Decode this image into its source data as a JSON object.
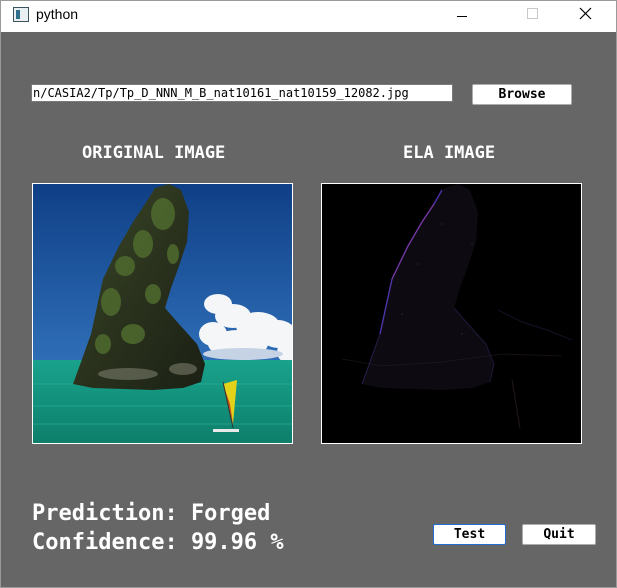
{
  "window": {
    "title": "python",
    "controls": [
      "minimize-icon",
      "maximize-icon",
      "close-icon"
    ]
  },
  "file": {
    "path_value": "n/CASIA2/Tp/Tp_D_NNN_M_B_nat10161_nat10159_12082.jpg",
    "browse_label": "Browse"
  },
  "images": {
    "original_heading": "ORIGINAL IMAGE",
    "ela_heading": "ELA IMAGE"
  },
  "result": {
    "prediction_text": "Prediction: Forged",
    "confidence_text": "Confidence: 99.96 %"
  },
  "actions": {
    "test_label": "Test",
    "quit_label": "Quit"
  },
  "colors": {
    "background": "#666666",
    "titlebar": "#ffffff",
    "text": "#ffffff",
    "test_border": "#1e6fcf"
  }
}
